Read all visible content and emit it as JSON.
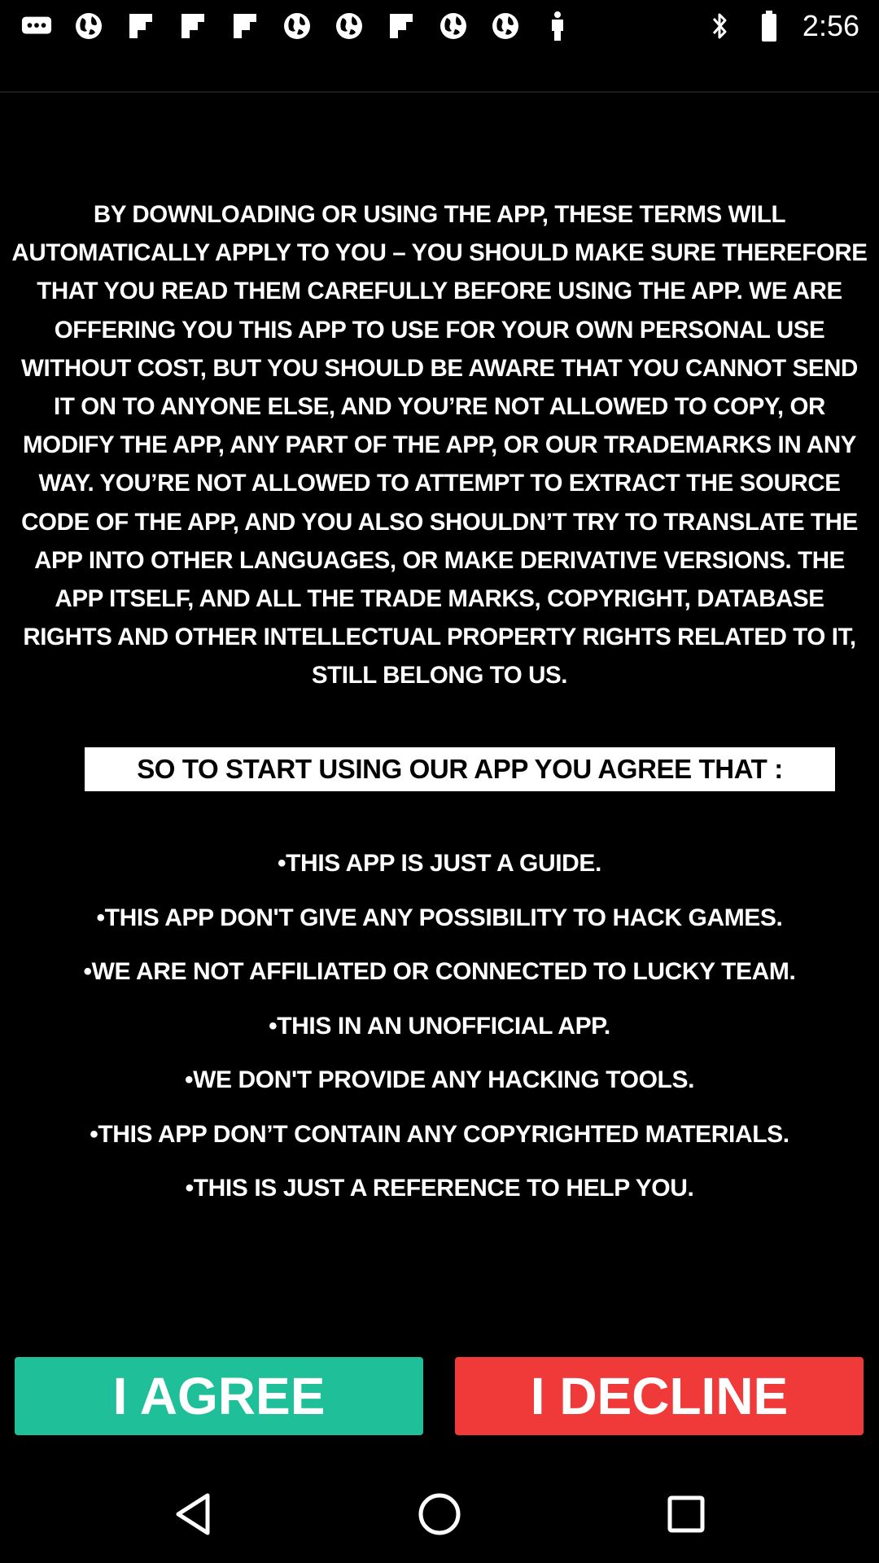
{
  "status_bar": {
    "time": "2:56",
    "left_icons": [
      "chat-icon",
      "globe-icon",
      "flipboard-icon",
      "flipboard-icon",
      "flipboard-icon",
      "globe-icon",
      "globe-icon",
      "flipboard-icon",
      "globe-icon",
      "globe-icon",
      "figure-icon"
    ],
    "right_icons": [
      "bluetooth-icon",
      "battery-icon"
    ]
  },
  "terms": {
    "paragraph": "BY DOWNLOADING OR USING THE APP, THESE TERMS WILL AUTOMATICALLY APPLY TO YOU – YOU SHOULD MAKE SURE THEREFORE THAT YOU READ THEM CAREFULLY BEFORE USING THE APP. WE ARE OFFERING YOU THIS APP TO USE FOR YOUR OWN PERSONAL USE WITHOUT COST, BUT YOU SHOULD BE AWARE THAT YOU CANNOT SEND IT ON TO ANYONE ELSE, AND YOU’RE NOT ALLOWED TO COPY, OR MODIFY THE APP, ANY PART OF THE APP, OR OUR TRADEMARKS IN ANY WAY. YOU’RE NOT ALLOWED TO ATTEMPT TO EXTRACT THE SOURCE CODE OF THE APP, AND YOU ALSO SHOULDN’T TRY TO TRANSLATE THE APP INTO OTHER LANGUAGES, OR MAKE DERIVATIVE VERSIONS. THE APP ITSELF, AND ALL THE TRADE MARKS, COPYRIGHT, DATABASE RIGHTS AND OTHER INTELLECTUAL PROPERTY RIGHTS RELATED TO IT, STILL BELONG TO US.",
    "heading": "SO TO START USING OUR APP YOU AGREE THAT :",
    "bullets": [
      "THIS APP IS JUST A GUIDE.",
      "THIS APP DON'T GIVE ANY POSSIBILITY TO HACK GAMES.",
      "WE ARE NOT AFFILIATED OR CONNECTED TO LUCKY TEAM.",
      "THIS IN AN UNOFFICIAL APP.",
      "WE DON'T PROVIDE ANY HACKING TOOLS.",
      "THIS APP DON’T CONTAIN ANY COPYRIGHTED MATERIALS.",
      "THIS IS JUST A REFERENCE TO HELP YOU."
    ]
  },
  "buttons": {
    "agree_label": "I AGREE",
    "decline_label": "I DECLINE",
    "agree_color": "#1fbf9a",
    "decline_color": "#f03a3a"
  },
  "nav_bar": {
    "icons": [
      "back-icon",
      "home-icon",
      "recents-icon"
    ]
  }
}
